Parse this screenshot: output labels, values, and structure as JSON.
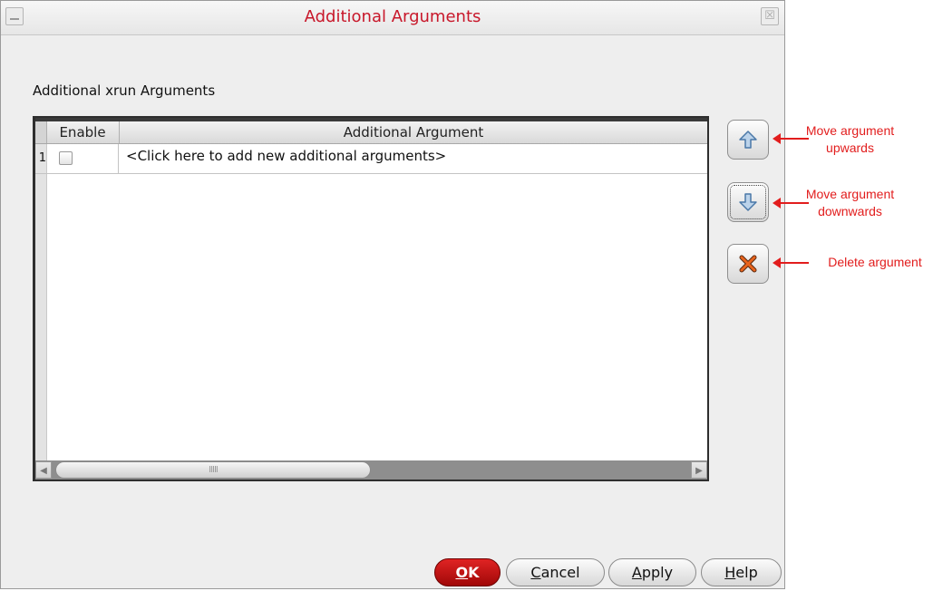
{
  "window": {
    "title": "Additional Arguments",
    "close_glyph": "☒"
  },
  "section": {
    "label": "Additional xrun Arguments"
  },
  "table": {
    "columns": [
      "Enable",
      "Additional Argument"
    ],
    "rows": [
      {
        "index": "1",
        "enabled": false,
        "argument": "<Click here to add new additional arguments>"
      }
    ],
    "scroll_grip": "IIIII"
  },
  "side_buttons": {
    "up_icon": "arrow-up-icon",
    "down_icon": "arrow-down-icon",
    "delete_icon": "delete-x-icon"
  },
  "annotations": {
    "up_line1": "Move argument",
    "up_line2": "upwards",
    "down_line1": "Move argument",
    "down_line2": "downwards",
    "delete": "Delete argument"
  },
  "buttons": {
    "ok_mn": "O",
    "ok_rest": "K",
    "cancel_mn": "C",
    "cancel_rest": "ancel",
    "apply_mn": "A",
    "apply_rest": "pply",
    "help_mn": "H",
    "help_rest": "elp"
  },
  "colors": {
    "title": "#c8172a",
    "annotation": "#e21d1d",
    "ok_button": "#c81313"
  }
}
